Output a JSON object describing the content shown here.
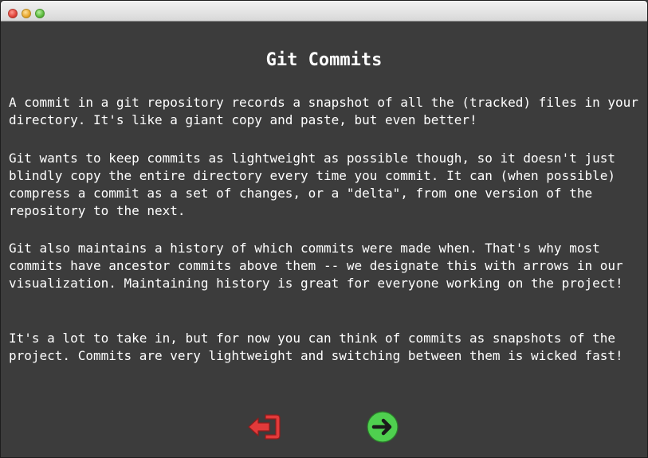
{
  "window": {
    "title": ""
  },
  "dialog": {
    "title": "Git Commits",
    "paragraphs": [
      "A commit in a git repository records a snapshot of all the (tracked) files in your directory. It's like a giant copy and paste, but even better!",
      "Git wants to keep commits as lightweight as possible though, so it doesn't just blindly copy the entire directory every time you commit. It can (when possible) compress a commit as a set of changes, or a \"delta\", from one version of the repository to the next.",
      "Git also maintains a history of which commits were made when. That's why most commits have ancestor commits above them -- we designate this with arrows in our visualization. Maintaining history is great for everyone working on the project!",
      "It's a lot to take in, but for now you can think of commits as snapshots of the project. Commits are very lightweight and switching between them is wicked fast!"
    ]
  },
  "navigation": {
    "back_icon": "exit-arrow-left-icon",
    "next_icon": "arrow-right-circle-icon",
    "back_color": "#e23a3a",
    "next_color": "#4fd04f"
  }
}
